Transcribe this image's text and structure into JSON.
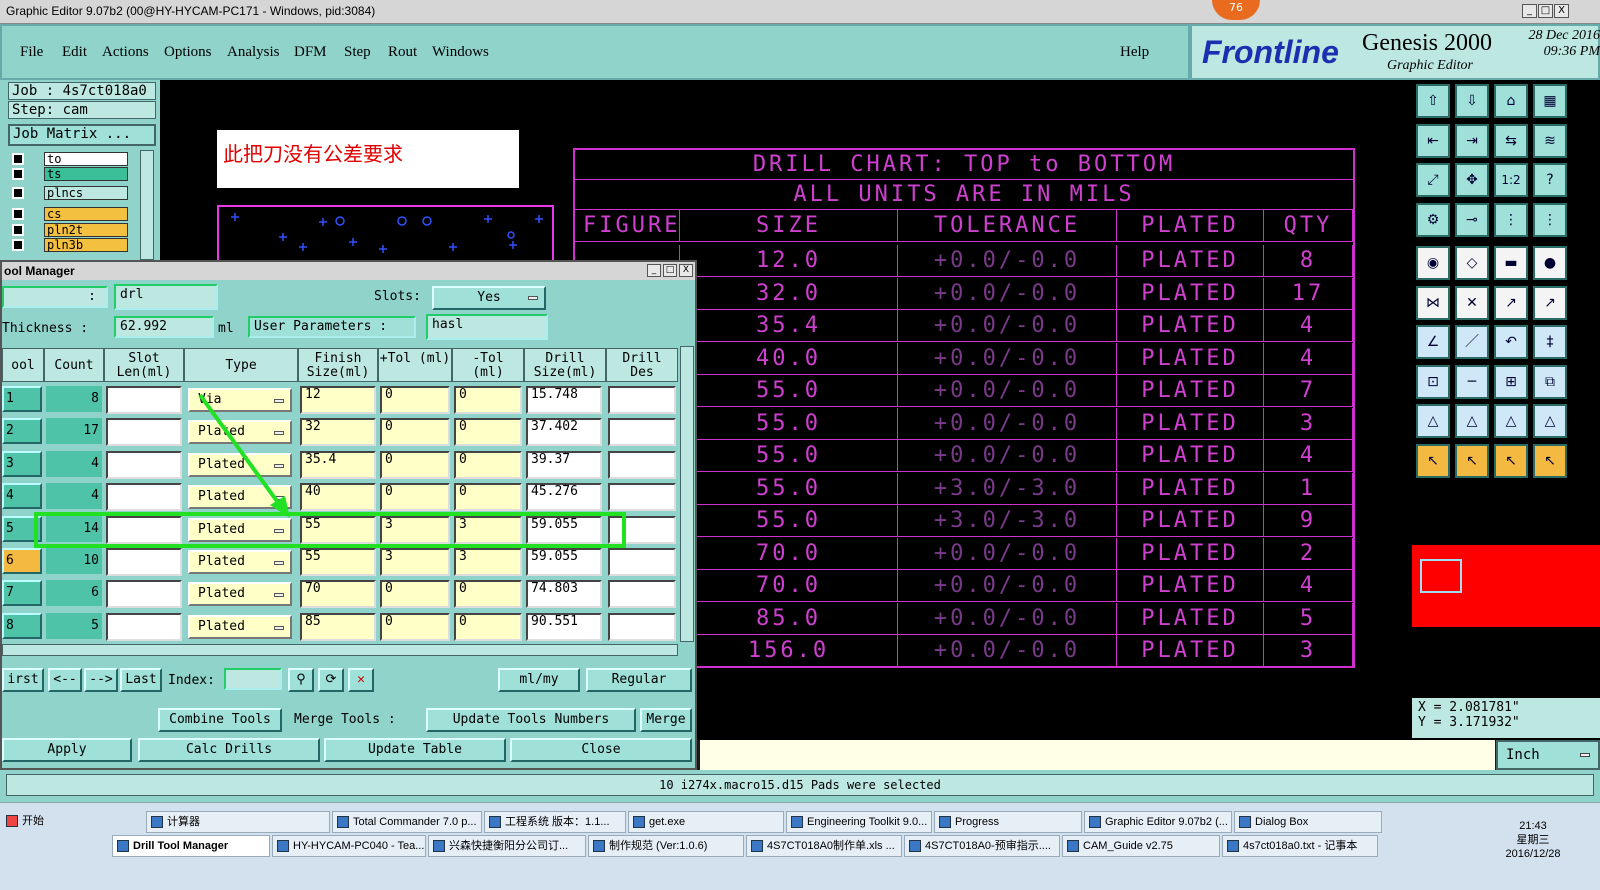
{
  "window": {
    "title": "Graphic Editor 9.07b2 (00@HY-HYCAM-PC171 - Windows, pid:3084)",
    "notification_badge": "76",
    "minimize": "_",
    "restore": "□",
    "close": "X"
  },
  "menu": [
    "File",
    "Edit",
    "Actions",
    "Options",
    "Analysis",
    "DFM",
    "Step",
    "Rout",
    "Windows"
  ],
  "help": "Help",
  "brand": {
    "logo": "Frontline",
    "product": "Genesis 2000",
    "subtitle": "Graphic Editor",
    "date": "28 Dec 2016",
    "time": "09:36 PM"
  },
  "job_panel": {
    "job": "Job : 4s7ct018a0",
    "step": "Step: cam",
    "job_matrix": "Job Matrix ...",
    "layers": [
      {
        "name": "to",
        "color": "#ffffff"
      },
      {
        "name": "ts",
        "color": "#3bbf99"
      },
      {
        "name": "plncs",
        "color": "#bde8e2"
      },
      {
        "name": "cs",
        "color": "#f4c040"
      },
      {
        "name": "pln2t",
        "color": "#f4c040"
      },
      {
        "name": "pln3b",
        "color": "#f4c040"
      }
    ]
  },
  "note": "此把刀没有公差要求",
  "drill_chart": {
    "title": "DRILL CHART: TOP to BOTTOM",
    "units": "ALL UNITS ARE IN MILS",
    "headers": [
      "FIGURE",
      "SIZE",
      "TOLERANCE",
      "PLATED",
      "QTY"
    ],
    "rows": [
      {
        "size": "12.0",
        "tol": "+0.0/-0.0",
        "plated": "PLATED",
        "qty": "8"
      },
      {
        "size": "32.0",
        "tol": "+0.0/-0.0",
        "plated": "PLATED",
        "qty": "17"
      },
      {
        "size": "35.4",
        "tol": "+0.0/-0.0",
        "plated": "PLATED",
        "qty": "4"
      },
      {
        "size": "40.0",
        "tol": "+0.0/-0.0",
        "plated": "PLATED",
        "qty": "4"
      },
      {
        "size": "55.0",
        "tol": "+0.0/-0.0",
        "plated": "PLATED",
        "qty": "7"
      },
      {
        "size": "55.0",
        "tol": "+0.0/-0.0",
        "plated": "PLATED",
        "qty": "3"
      },
      {
        "size": "55.0",
        "tol": "+0.0/-0.0",
        "plated": "PLATED",
        "qty": "4"
      },
      {
        "size": "55.0",
        "tol": "+3.0/-3.0",
        "plated": "PLATED",
        "qty": "1"
      },
      {
        "size": "55.0",
        "tol": "+3.0/-3.0",
        "plated": "PLATED",
        "qty": "9"
      },
      {
        "size": "70.0",
        "tol": "+0.0/-0.0",
        "plated": "PLATED",
        "qty": "2"
      },
      {
        "size": "70.0",
        "tol": "+0.0/-0.0",
        "plated": "PLATED",
        "qty": "4"
      },
      {
        "size": "85.0",
        "tol": "+0.0/-0.0",
        "plated": "PLATED",
        "qty": "5"
      },
      {
        "size": "156.0",
        "tol": "+0.0/-0.0",
        "plated": "PLATED",
        "qty": "3"
      }
    ]
  },
  "coords": {
    "x": "X = 2.081781\"",
    "y": "Y = 3.171932\""
  },
  "units_select": "Inch",
  "status": "10 i274x.macro15.d15 Pads were selected",
  "dialog": {
    "title": "ool Manager",
    "layer_label": ":",
    "layer_value": "drl",
    "slots_label": "Slots:",
    "slots_value": "Yes",
    "thickness_label": "Thickness :",
    "thickness_value": "62.992",
    "thickness_unit": "ml",
    "user_params_label": "User Parameters :",
    "user_params_value": "hasl",
    "headers": [
      "ool",
      "Count",
      "Slot Len(ml)",
      "Type",
      "Finish Size(ml)",
      "+Tol (ml)",
      "-Tol (ml)",
      "Drill Size(ml)",
      "Drill Des"
    ],
    "rows": [
      {
        "tool": "1",
        "count": "8",
        "type": "Via",
        "finish": "12",
        "ptol": "0",
        "mtol": "0",
        "drill": "15.748"
      },
      {
        "tool": "2",
        "count": "17",
        "type": "Plated",
        "finish": "32",
        "ptol": "0",
        "mtol": "0",
        "drill": "37.402"
      },
      {
        "tool": "3",
        "count": "4",
        "type": "Plated",
        "finish": "35.4",
        "ptol": "0",
        "mtol": "0",
        "drill": "39.37"
      },
      {
        "tool": "4",
        "count": "4",
        "type": "Plated",
        "finish": "40",
        "ptol": "0",
        "mtol": "0",
        "drill": "45.276"
      },
      {
        "tool": "5",
        "count": "14",
        "type": "Plated",
        "finish": "55",
        "ptol": "3",
        "mtol": "3",
        "drill": "59.055"
      },
      {
        "tool": "6",
        "count": "10",
        "type": "Plated",
        "finish": "55",
        "ptol": "3",
        "mtol": "3",
        "drill": "59.055"
      },
      {
        "tool": "7",
        "count": "6",
        "type": "Plated",
        "finish": "70",
        "ptol": "0",
        "mtol": "0",
        "drill": "74.803"
      },
      {
        "tool": "8",
        "count": "5",
        "type": "Plated",
        "finish": "85",
        "ptol": "0",
        "mtol": "0",
        "drill": "90.551"
      }
    ],
    "nav": {
      "first": "irst",
      "prev": "<--",
      "next": "-->",
      "last": "Last",
      "index": "Index:"
    },
    "unit_sel": "ml/my",
    "mode_sel": "Regular",
    "combine": "Combine Tools",
    "merge_tools": "Merge Tools :",
    "update_numbers": "Update Tools Numbers",
    "merge": "Merge",
    "apply": "Apply",
    "calc": "Calc Drills",
    "update_table": "Update Table",
    "close": "Close"
  },
  "taskbar": {
    "start": "开始",
    "row1": [
      "计算器",
      "Total Commander 7.0 p...",
      "工程系统  版本：1.1...",
      "get.exe",
      "Engineering Toolkit 9.0...",
      "Progress",
      "Graphic Editor 9.07b2 (...",
      "Dialog Box"
    ],
    "row2": [
      "Drill Tool Manager",
      "HY-HYCAM-PC040 - Tea...",
      "兴森快捷衡阳分公司订...",
      "制作规范 (Ver:1.0.6)",
      "4S7CT018A0制作单.xls ...",
      "4S7CT018A0-预审指示....",
      "CAM_Guide v2.75",
      "4s7ct018a0.txt - 记事本"
    ],
    "clock_time": "21:43",
    "clock_day": "星期三",
    "clock_date": "2016/12/28"
  }
}
